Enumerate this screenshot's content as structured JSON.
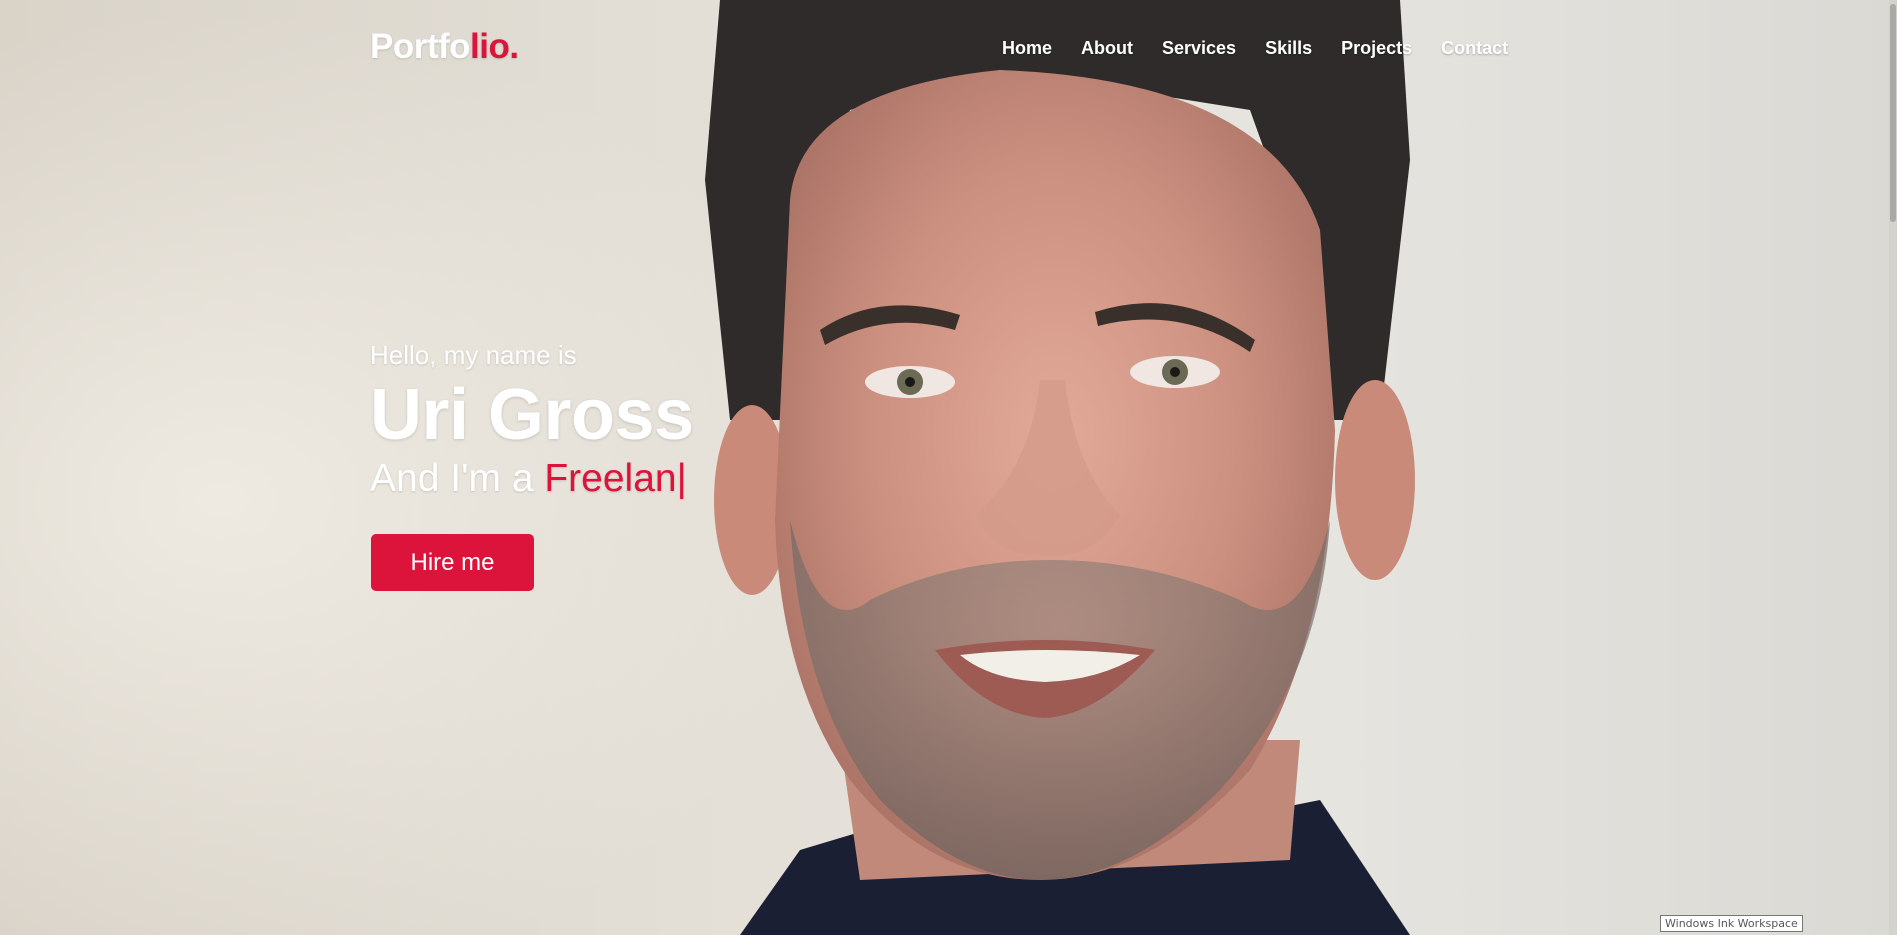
{
  "brand": {
    "logo_main": "Portfo",
    "logo_accent": "lio."
  },
  "nav": {
    "items": [
      {
        "label": "Home"
      },
      {
        "label": "About"
      },
      {
        "label": "Services"
      },
      {
        "label": "Skills"
      },
      {
        "label": "Projects"
      },
      {
        "label": "Contact"
      }
    ]
  },
  "hero": {
    "greeting": "Hello, my name is",
    "name": "Uri Gross",
    "role_prefix": "And I'm a ",
    "role_typed": "Freelan",
    "cursor": "|",
    "button_label": "Hire me"
  },
  "tooltip": {
    "text": "Windows Ink Workspace"
  },
  "colors": {
    "accent": "#dc143c",
    "text": "#ffffff"
  }
}
